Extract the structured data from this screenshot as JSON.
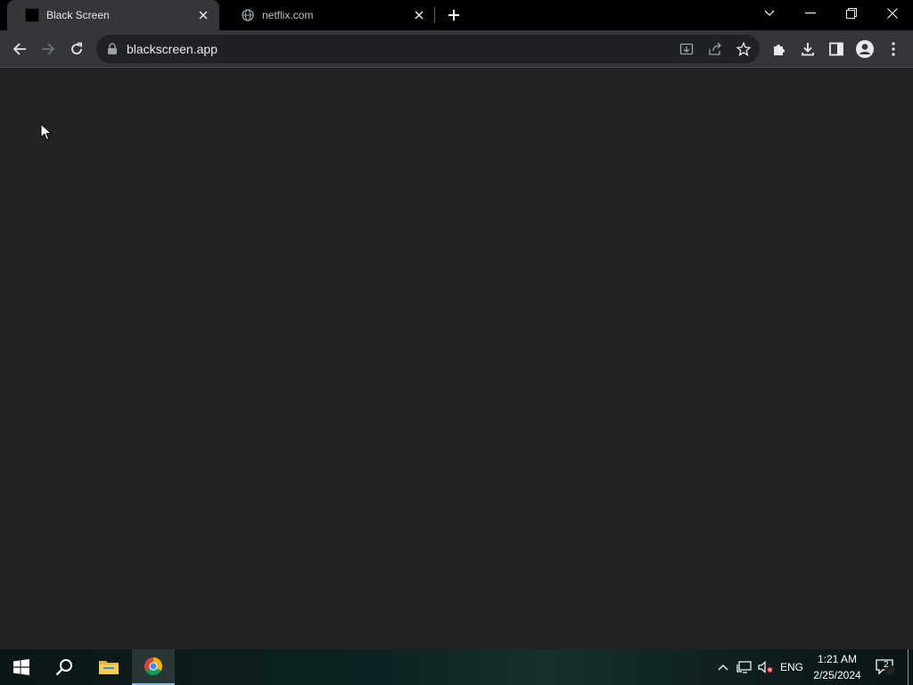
{
  "browser": {
    "tabs": [
      {
        "title": "Black Screen",
        "favicon": "black-square-icon",
        "active": true
      },
      {
        "title": "netflix.com",
        "favicon": "globe-icon",
        "active": false
      }
    ],
    "address": {
      "url": "blackscreen.app",
      "secure": true
    }
  },
  "taskbar": {
    "apps": [
      "start-icon",
      "search-icon",
      "file-explorer-icon",
      "chrome-icon"
    ],
    "tray": {
      "language": "ENG",
      "time": "1:21 AM",
      "date": "2/25/2024",
      "notifications": "2"
    }
  },
  "colors": {
    "page_background": "#232323",
    "toolbar": "#35363a",
    "titlebar": "#000000"
  }
}
